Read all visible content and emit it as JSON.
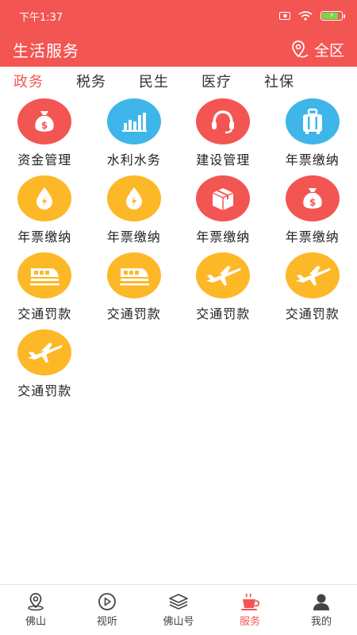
{
  "status_bar": {
    "time": "下午1:37"
  },
  "header": {
    "title": "生活服务",
    "location": "全区"
  },
  "tabs": [
    {
      "label": "政务",
      "active": true
    },
    {
      "label": "税务",
      "active": false
    },
    {
      "label": "民生",
      "active": false
    },
    {
      "label": "医疗",
      "active": false
    },
    {
      "label": "社保",
      "active": false
    }
  ],
  "services": [
    {
      "label": "资金管理",
      "icon": "money-bag-icon",
      "color": "#f35552"
    },
    {
      "label": "水利水务",
      "icon": "bar-chart-icon",
      "color": "#3fb6ea"
    },
    {
      "label": "建设管理",
      "icon": "headset-icon",
      "color": "#f35552"
    },
    {
      "label": "年票缴纳",
      "icon": "luggage-icon",
      "color": "#3fb6ea"
    },
    {
      "label": "年票缴纳",
      "icon": "water-drop-icon",
      "color": "#fdb827"
    },
    {
      "label": "年票缴纳",
      "icon": "water-drop-icon",
      "color": "#fdb827"
    },
    {
      "label": "年票缴纳",
      "icon": "package-box-icon",
      "color": "#f35552"
    },
    {
      "label": "年票缴纳",
      "icon": "money-bag-icon",
      "color": "#f35552"
    },
    {
      "label": "交通罚款",
      "icon": "train-icon",
      "color": "#fdb827"
    },
    {
      "label": "交通罚款",
      "icon": "train-icon",
      "color": "#fdb827"
    },
    {
      "label": "交通罚款",
      "icon": "airplane-icon",
      "color": "#fdb827"
    },
    {
      "label": "交通罚款",
      "icon": "airplane-icon",
      "color": "#fdb827"
    },
    {
      "label": "交通罚款",
      "icon": "airplane-icon",
      "color": "#fdb827"
    }
  ],
  "bottom_nav": [
    {
      "label": "佛山",
      "icon": "location-pin-icon",
      "active": false
    },
    {
      "label": "视听",
      "icon": "play-circle-icon",
      "active": false
    },
    {
      "label": "佛山号",
      "icon": "layers-icon",
      "active": false
    },
    {
      "label": "服务",
      "icon": "coffee-cup-icon",
      "active": true
    },
    {
      "label": "我的",
      "icon": "user-icon",
      "active": false
    }
  ],
  "colors": {
    "brand_red": "#f35552",
    "blue": "#3fb6ea",
    "yellow": "#fdb827"
  }
}
